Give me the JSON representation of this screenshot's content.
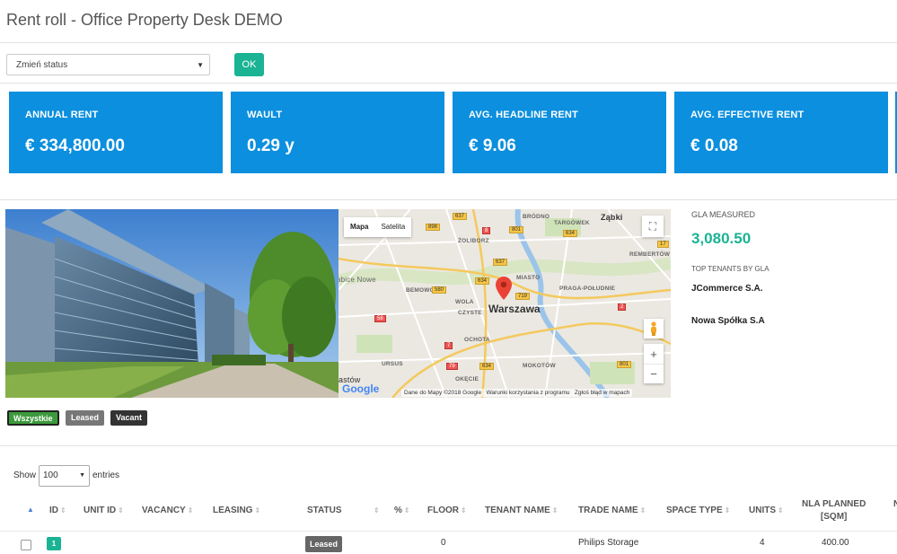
{
  "page": {
    "title": "Rent roll - Office Property Desk DEMO"
  },
  "toolbar": {
    "status_select": "Zmień status",
    "ok_label": "OK"
  },
  "kpis": [
    {
      "label": "ANNUAL RENT",
      "value": "€ 334,800.00"
    },
    {
      "label": "WAULT",
      "value": "0.29 y"
    },
    {
      "label": "AVG. HEADLINE RENT",
      "value": "€ 9.06"
    },
    {
      "label": "AVG. EFFECTIVE RENT",
      "value": "€ 0.08"
    }
  ],
  "map": {
    "type_map": "Mapa",
    "type_satellite": "Satelita",
    "city": "Warszawa",
    "attribution": "Dane do Mapy ©2018 Google",
    "terms": "Warunki korzystania z programu",
    "report": "Zgłoś błąd w mapach",
    "logo": "Google",
    "places": [
      "Ząbki",
      "BRÓDNO",
      "TARGÓWEK",
      "ŻOLIBORZ",
      "REMBERTÓW",
      "abice Nowe",
      "BEMOWO",
      "MIASTO",
      "PRAGA-POŁUDNIE",
      "WOLA",
      "CZYSTE",
      "OCHOTA",
      "URSUS",
      "MOKOTÓW",
      "OKĘCIE",
      "astów"
    ],
    "roads": [
      "637",
      "898",
      "8",
      "801",
      "634",
      "580",
      "637",
      "634",
      "719",
      "2",
      "58",
      "7",
      "79",
      "634",
      "801",
      "17"
    ]
  },
  "gla": {
    "label": "GLA MEASURED",
    "value": "3,080.50",
    "top_label": "TOP TENANTS BY GLA",
    "tenants": [
      "JCommerce S.A.",
      "Nowa Spółka S.A"
    ]
  },
  "filters": {
    "all": "Wszystkie",
    "leased": "Leased",
    "vacant": "Vacant"
  },
  "table": {
    "show": "Show",
    "length": "100",
    "entries": "entries",
    "headers": {
      "id": "ID",
      "unit_id": "UNIT ID",
      "vacancy": "VACANCY",
      "leasing": "LEASING",
      "status": "STATUS",
      "pct": "%",
      "floor": "FLOOR",
      "tenant_name": "TENANT NAME",
      "trade_name": "TRADE NAME",
      "space_type": "SPACE TYPE",
      "units": "UNITS",
      "nla_planned_1": "NLA PLANNED",
      "nla_planned_2": "[SQM]"
    },
    "rows": [
      {
        "id": "1",
        "status": "Leased",
        "floor": "0",
        "trade_name": "Philips Storage",
        "units": "4",
        "nla_planned": "400.00"
      }
    ]
  },
  "colors": {
    "kpi_blue": "#0b8fde",
    "accent_green": "#1ab394"
  }
}
